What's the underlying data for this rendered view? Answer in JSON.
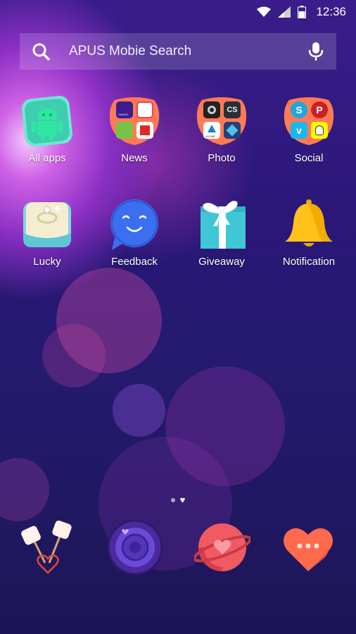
{
  "status_bar": {
    "time": "12:36"
  },
  "search": {
    "placeholder": "APUS Mobie Search"
  },
  "apps_row1": [
    {
      "label": "All apps",
      "icon": "android-icon"
    },
    {
      "label": "News",
      "icon": "news-folder-icon"
    },
    {
      "label": "Photo",
      "icon": "photo-folder-icon"
    },
    {
      "label": "Social",
      "icon": "social-folder-icon"
    }
  ],
  "apps_row2": [
    {
      "label": "Lucky",
      "icon": "ring-box-icon"
    },
    {
      "label": "Feedback",
      "icon": "smiley-bubble-icon"
    },
    {
      "label": "Giveaway",
      "icon": "gift-box-icon"
    },
    {
      "label": "Notification",
      "icon": "bell-icon"
    }
  ],
  "news_folder": {
    "mini_labels": [
      "YAHOO"
    ]
  },
  "photo_folder": {
    "mini_labels": [
      "CS",
      "ADOBE"
    ]
  },
  "page_indicator": {
    "pages": 2,
    "current": 2
  },
  "dock": [
    "marshmallow-heart-icon",
    "purple-camera-icon",
    "planet-heart-icon",
    "heart-chat-icon"
  ],
  "colors": {
    "accent": "#ff6a4d",
    "teal": "#4fe0c0",
    "bell": "#ffc21a"
  }
}
